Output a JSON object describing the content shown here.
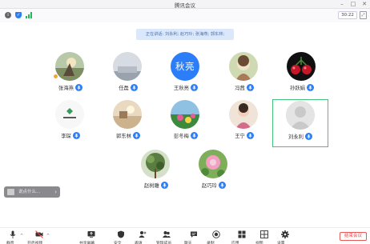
{
  "window": {
    "title": "腾讯会议",
    "controls": [
      "minimize-icon",
      "maximize-icon",
      "close-icon"
    ]
  },
  "status_bar": {
    "icons": [
      "info-icon",
      "shield-icon",
      "signal-icon"
    ],
    "timer": "30:22",
    "fullscreen_icon": "fullscreen-icon"
  },
  "speaking_banner": {
    "text": "正在讲话: 刘永利; 赵巧玲; 张海燕; 郭东林;"
  },
  "participants": [
    {
      "name": "张海燕",
      "avatar": "photo",
      "host": true
    },
    {
      "name": "任磊",
      "avatar": "photo",
      "host": false
    },
    {
      "name": "王秋亮",
      "avatar": "text",
      "avatar_text": "秋亮",
      "host": false
    },
    {
      "name": "冯茜",
      "avatar": "photo",
      "host": false
    },
    {
      "name": "孙跃娟",
      "avatar": "photo",
      "host": false
    },
    {
      "name": "李琛",
      "avatar": "photo",
      "host": false
    },
    {
      "name": "郭东林",
      "avatar": "photo",
      "host": false
    },
    {
      "name": "彭冬梅",
      "avatar": "photo",
      "host": false
    },
    {
      "name": "王宁",
      "avatar": "photo",
      "host": false
    },
    {
      "name": "刘永利",
      "avatar": "default",
      "host": false,
      "active": true
    },
    {
      "name": "赵树雕",
      "avatar": "photo",
      "host": false
    },
    {
      "name": "赵巧玲",
      "avatar": "photo",
      "host": false
    }
  ],
  "chat_input": {
    "placeholder": "说点什么...",
    "icon": "chat-icon"
  },
  "toolbar": {
    "buttons": [
      {
        "id": "mute",
        "label": "静音",
        "icon": "microphone-icon"
      },
      {
        "id": "video",
        "label": "开启视频",
        "icon": "camera-off-icon"
      },
      {
        "id": "share",
        "label": "共享屏幕",
        "icon": "share-screen-icon"
      },
      {
        "id": "security",
        "label": "安全",
        "icon": "shield-icon"
      },
      {
        "id": "invite",
        "label": "邀请",
        "icon": "add-user-icon"
      },
      {
        "id": "members",
        "label": "管理成员",
        "icon": "members-icon"
      },
      {
        "id": "chat",
        "label": "聊天",
        "icon": "chat-icon"
      },
      {
        "id": "record",
        "label": "录制",
        "icon": "record-icon"
      },
      {
        "id": "apps",
        "label": "应用",
        "icon": "apps-icon"
      },
      {
        "id": "view",
        "label": "视图",
        "icon": "view-icon"
      },
      {
        "id": "settings",
        "label": "设置",
        "icon": "gear-icon"
      }
    ],
    "end_label": "结束会议"
  },
  "colors": {
    "accent": "#2b7ef7",
    "active_border": "#43c27b",
    "end": "#e04848",
    "banner_bg": "#dbe8fb",
    "banner_text": "#4a6ea9"
  }
}
